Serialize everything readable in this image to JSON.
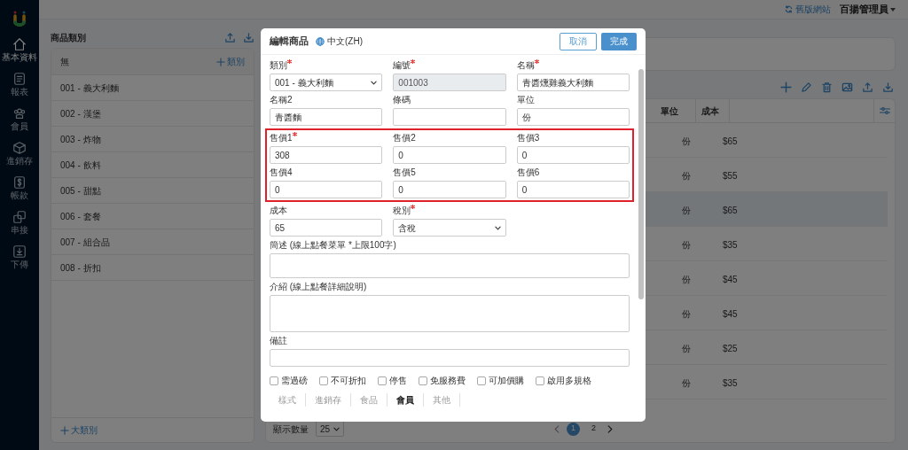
{
  "sidebar": {
    "items": [
      {
        "label": "基本資料",
        "selected": true
      },
      {
        "label": "報表",
        "selected": false
      },
      {
        "label": "會員",
        "selected": false
      },
      {
        "label": "進銷存",
        "selected": false
      },
      {
        "label": "帳款",
        "selected": false
      },
      {
        "label": "串接",
        "selected": false
      },
      {
        "label": "下傳",
        "selected": false
      }
    ]
  },
  "top_bar": {
    "old_site_link": "舊版網站",
    "user": "百揚管理員"
  },
  "categories": {
    "title": "商品類別",
    "header": "無",
    "add_category": "類別",
    "items": [
      {
        "label": "001 - 義大利麵"
      },
      {
        "label": "002 - 漢堡"
      },
      {
        "label": "003 - 炸物"
      },
      {
        "label": "004 - 飲料"
      },
      {
        "label": "005 - 甜點"
      },
      {
        "label": "006 - 套餐"
      },
      {
        "label": "007 - 組合品"
      },
      {
        "label": "008 - 折扣"
      }
    ],
    "add_major_category": "大類別"
  },
  "table": {
    "columns": [
      "單位",
      "成本"
    ],
    "rows": [
      {
        "cells": [
          "份",
          "$65"
        ],
        "selected": false
      },
      {
        "cells": [
          "份",
          "$55"
        ],
        "selected": false
      },
      {
        "cells": [
          "份",
          "$65"
        ],
        "selected": true
      },
      {
        "cells": [
          "份",
          "$35"
        ],
        "selected": false
      },
      {
        "cells": [
          "份",
          "$45"
        ],
        "selected": false
      },
      {
        "cells": [
          "份",
          "$45"
        ],
        "selected": false
      },
      {
        "cells": [
          "份",
          "$25"
        ],
        "selected": false
      },
      {
        "cells": [
          "份",
          "$35"
        ],
        "selected": false
      }
    ]
  },
  "pagination": {
    "page_size_label": "顯示數量",
    "page_size": "25",
    "pages": [
      {
        "label": "1",
        "selected": true
      },
      {
        "label": "2",
        "selected": false
      }
    ]
  },
  "dialog": {
    "title": "編輯商品",
    "language": "中文(ZH)",
    "cancel": "取消",
    "confirm": "完成",
    "sections": [
      {
        "highlighted": false,
        "fields": [
          {
            "label": "類別",
            "required": true,
            "kind": "select",
            "value": "001 - 義大利麵",
            "disabled": false
          },
          {
            "label": "編號",
            "required": true,
            "kind": "input",
            "value": "001003",
            "disabled": true
          },
          {
            "label": "名稱",
            "required": true,
            "kind": "input",
            "value": "青醬燻雞義大利麵",
            "disabled": false
          },
          {
            "label": "名稱2",
            "required": false,
            "kind": "input",
            "value": "青醬麵",
            "disabled": false
          },
          {
            "label": "條碼",
            "required": false,
            "kind": "input",
            "disabled": false
          },
          {
            "label": "單位",
            "required": false,
            "kind": "input",
            "value": "份",
            "disabled": false
          }
        ]
      },
      {
        "highlighted": true,
        "fields": [
          {
            "label": "售價1",
            "required": true,
            "kind": "input",
            "value": "308",
            "disabled": false
          },
          {
            "label": "售價2",
            "required": false,
            "kind": "input",
            "value": "0",
            "disabled": false
          },
          {
            "label": "售價3",
            "required": false,
            "kind": "input",
            "value": "0",
            "disabled": false
          },
          {
            "label": "售價4",
            "required": false,
            "kind": "input",
            "value": "0",
            "disabled": false
          },
          {
            "label": "售價5",
            "required": false,
            "kind": "input",
            "value": "0",
            "disabled": false
          },
          {
            "label": "售價6",
            "required": false,
            "kind": "input",
            "value": "0",
            "disabled": false
          }
        ]
      },
      {
        "highlighted": false,
        "fields": [
          {
            "label": "成本",
            "required": false,
            "kind": "input",
            "value": "65",
            "disabled": false
          },
          {
            "label": "稅別",
            "required": true,
            "kind": "select",
            "value": "含稅",
            "disabled": false
          }
        ]
      }
    ],
    "wide_fields": [
      {
        "label": "簡述 (線上點餐菜單 *上限100字)",
        "kind": "textarea"
      },
      {
        "label": "介紹 (線上點餐詳細說明)",
        "kind": "textarea"
      },
      {
        "label": "備註",
        "kind": "input"
      }
    ],
    "checkboxes": [
      {
        "label": "需過磅",
        "checked": false
      },
      {
        "label": "不可折扣",
        "checked": false
      },
      {
        "label": "停售",
        "checked": false
      },
      {
        "label": "免服務費",
        "checked": false
      },
      {
        "label": "可加價購",
        "checked": false
      },
      {
        "label": "啟用多規格",
        "checked": false
      }
    ],
    "tabs": [
      {
        "label": "樣式",
        "selected": false
      },
      {
        "label": "進銷存",
        "selected": false
      },
      {
        "label": "食品",
        "selected": false
      },
      {
        "label": "會員",
        "selected": true
      },
      {
        "label": "其他",
        "selected": false
      }
    ]
  }
}
